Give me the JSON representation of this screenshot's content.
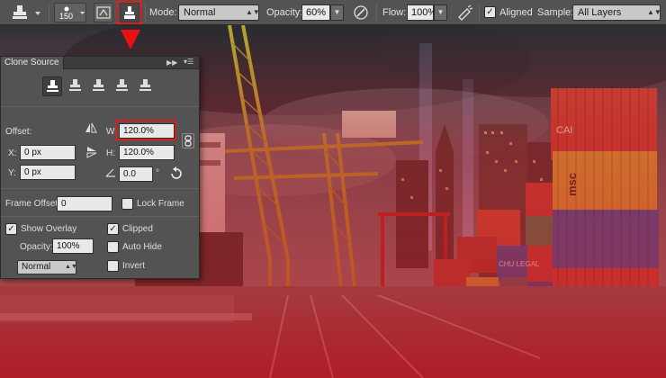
{
  "toolbar": {
    "brush_size": "150",
    "mode_label": "Mode:",
    "mode_value": "Normal",
    "opacity_label": "Opacity:",
    "opacity_value": "60%",
    "flow_label": "Flow:",
    "flow_value": "100%",
    "aligned_label": "Aligned",
    "aligned_checked": true,
    "sample_label": "Sample:",
    "sample_value": "All Layers"
  },
  "panel": {
    "title": "Clone Source",
    "offset_label": "Offset:",
    "w_label": "W:",
    "w_value": "120.0%",
    "h_label": "H:",
    "h_value": "120.0%",
    "x_label": "X:",
    "x_value": "0 px",
    "y_label": "Y:",
    "y_value": "0 px",
    "angle_value": "0.0",
    "deg_symbol": "°",
    "frame_offset_label": "Frame Offset:",
    "frame_offset_value": "0",
    "lock_frame_label": "Lock Frame",
    "show_overlay_label": "Show Overlay",
    "clipped_label": "Clipped",
    "opacity_label": "Opacity:",
    "opacity_value": "100%",
    "auto_hide_label": "Auto Hide",
    "blend_value": "Normal",
    "invert_label": "Invert"
  },
  "scene": {
    "container_labels": [
      "CAI",
      "msc",
      "CHU LEGAL"
    ]
  },
  "colors": {
    "highlight": "#d81f1f",
    "overlay": "#c4141e",
    "panel_bg": "#535353"
  }
}
